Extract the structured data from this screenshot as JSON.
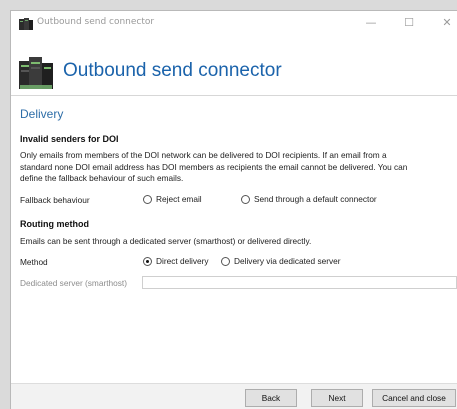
{
  "window": {
    "title": "Outbound send connector"
  },
  "header": {
    "title": "Outbound send connector"
  },
  "section": {
    "title": "Delivery"
  },
  "invalid_senders": {
    "heading": "Invalid senders for DOI",
    "description_line1": "Only emails from members of the DOI network can be delivered to DOI recipients. If an email from a",
    "description_line2": "standard none DOI email address has DOI members as recipients the email cannot be delivered. You can",
    "description_line3": "define the fallback behaviour of such emails.",
    "fallback_label": "Fallback behaviour",
    "options": [
      {
        "label": "Reject email",
        "checked": false
      },
      {
        "label": "Send through a default connector",
        "checked": false
      }
    ]
  },
  "routing": {
    "heading": "Routing method",
    "description": "Emails can be sent through a dedicated server (smarthost) or delivered directly.",
    "method_label": "Method",
    "options": [
      {
        "label": "Direct delivery",
        "checked": true
      },
      {
        "label": "Delivery via dedicated server",
        "checked": false
      }
    ],
    "smarthost_label": "Dedicated server (smarthost)",
    "smarthost_value": ""
  },
  "footer": {
    "back_label": "Back",
    "next_label": "Next",
    "cancel_label": "Cancel and close"
  },
  "icons": {
    "app": "server-rack-icon",
    "minimize": "minimize-icon",
    "maximize": "maximize-icon",
    "close": "close-icon"
  },
  "colors": {
    "accent": "#1b63ab",
    "section": "#2e6ea8"
  }
}
